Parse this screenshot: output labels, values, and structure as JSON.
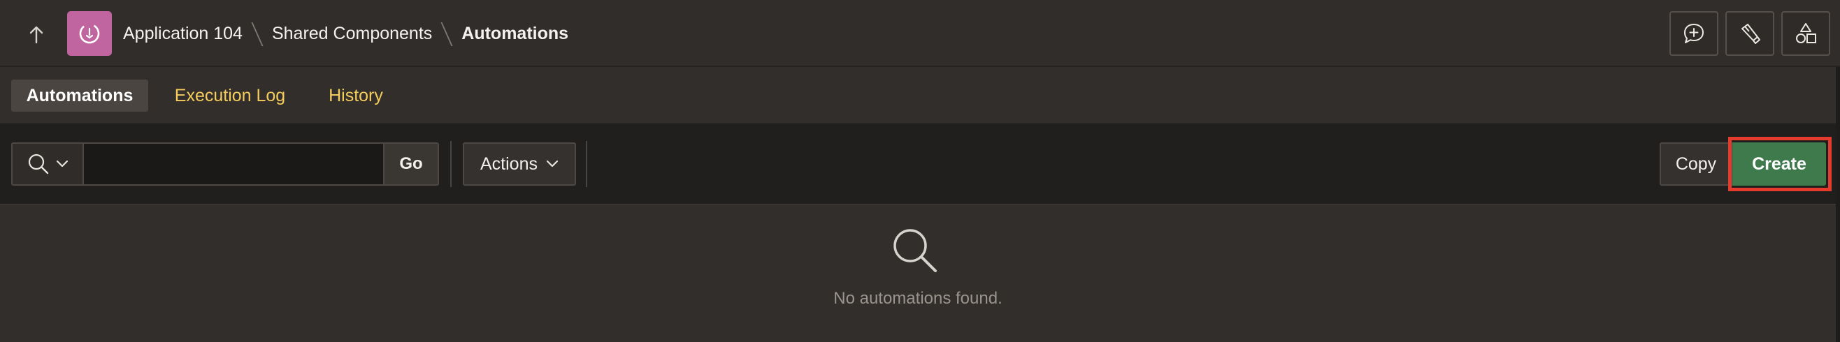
{
  "header": {
    "breadcrumbs": [
      {
        "label": "Application 104"
      },
      {
        "label": "Shared Components"
      },
      {
        "label": "Automations"
      }
    ],
    "icons": {
      "up": "arrow-up-icon",
      "app": "app-badge-icon",
      "feedback": "chat-plus-icon",
      "dev": "flashlight-icon",
      "shapes": "shapes-icon"
    }
  },
  "tabs": [
    {
      "label": "Automations",
      "active": true
    },
    {
      "label": "Execution Log",
      "active": false
    },
    {
      "label": "History",
      "active": false
    }
  ],
  "toolbar": {
    "search": {
      "value": "",
      "placeholder": ""
    },
    "go_label": "Go",
    "actions_label": "Actions",
    "copy_label": "Copy",
    "create_label": "Create"
  },
  "empty_state": {
    "message": "No automations found."
  },
  "colors": {
    "accent_tab": "#f5cd5c",
    "create": "#3f7a4d",
    "highlight": "#e53b2c",
    "app_badge": "#c0659f"
  }
}
